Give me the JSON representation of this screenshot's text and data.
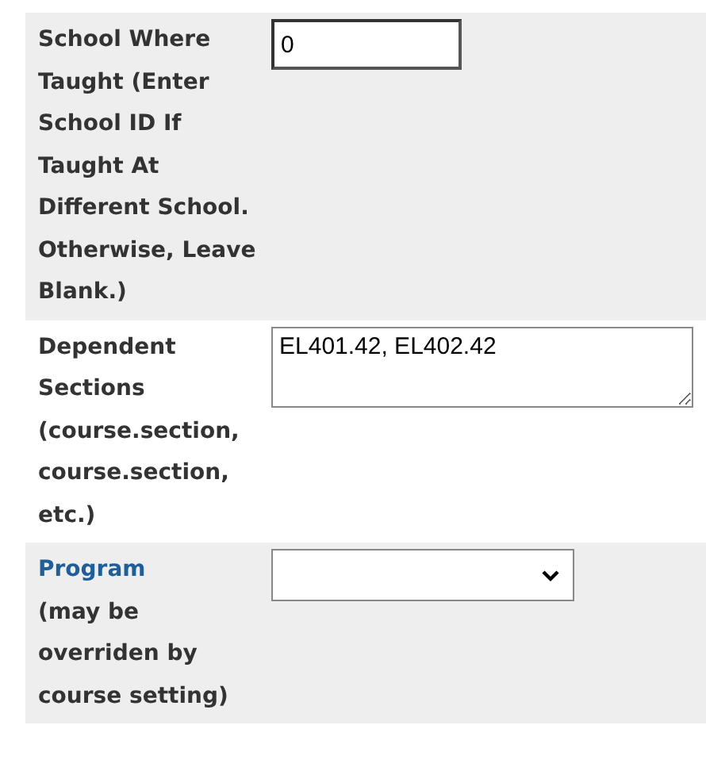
{
  "rows": [
    {
      "label": "School Where Taught (Enter School ID If Taught At Different School. Otherwise, Leave Blank.)",
      "link": false,
      "field": {
        "kind": "text",
        "value": "0"
      }
    },
    {
      "label": "Dependent Sections (course.section, course.section, etc.)",
      "link": false,
      "field": {
        "kind": "textarea",
        "value": "EL401.42, EL402.42"
      }
    },
    {
      "label": "Program",
      "link": true,
      "note": "(may be overriden by course setting)",
      "field": {
        "kind": "select"
      }
    }
  ]
}
